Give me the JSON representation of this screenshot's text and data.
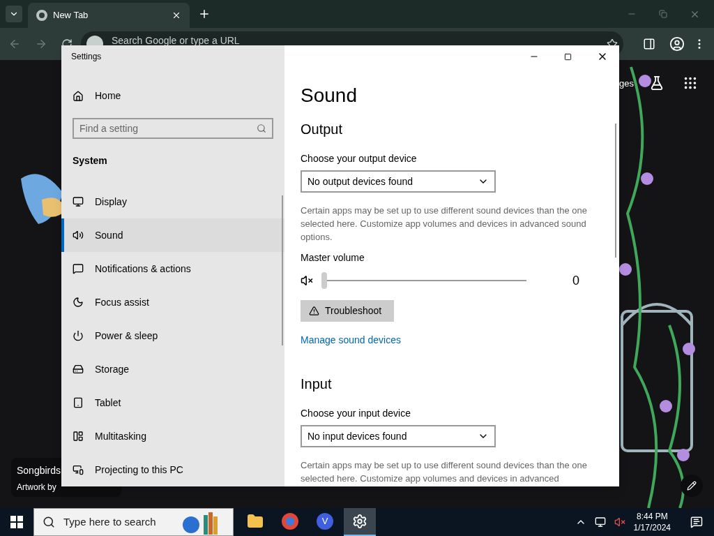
{
  "browser": {
    "tabs": [
      {
        "label": "New Tab",
        "selected": true
      }
    ],
    "omnibox": {
      "placeholder": "Search Google or type a URL"
    },
    "corner_link": "ges",
    "wallpaper_caption": {
      "title": "Songbirds",
      "credit": "Artwork by"
    }
  },
  "settings_window": {
    "title": "Settings",
    "home": "Home",
    "search": {
      "placeholder": "Find a setting"
    },
    "section": "System",
    "sidebar_items": [
      {
        "label": "Display",
        "selected": false
      },
      {
        "label": "Sound",
        "selected": true
      },
      {
        "label": "Notifications & actions",
        "selected": false
      },
      {
        "label": "Focus assist",
        "selected": false
      },
      {
        "label": "Power & sleep",
        "selected": false
      },
      {
        "label": "Storage",
        "selected": false
      },
      {
        "label": "Tablet",
        "selected": false
      },
      {
        "label": "Multitasking",
        "selected": false
      },
      {
        "label": "Projecting to this PC",
        "selected": false
      }
    ],
    "page_title": "Sound",
    "output": {
      "heading": "Output",
      "device_label": "Choose your output device",
      "device": "No output devices found",
      "note": "Certain apps may be set up to use different sound devices than the one selected here. Customize app volumes and devices in advanced sound options.",
      "volume_label": "Master volume",
      "muted": true,
      "level": 0,
      "reading": "0",
      "troubleshoot": "Troubleshoot",
      "manage_link": "Manage sound devices"
    },
    "input": {
      "heading": "Input",
      "device_label": "Choose your input device",
      "device": "No input devices found",
      "note": "Certain apps may be set up to use different sound devices than the one selected here. Customize app volumes and devices in advanced"
    }
  },
  "taskbar": {
    "search": {
      "placeholder": "Type here to search"
    },
    "apps": [
      {
        "kind": "explorer",
        "selected": false
      },
      {
        "kind": "chrome",
        "selected": false
      },
      {
        "kind": "v",
        "label": "V",
        "selected": false
      },
      {
        "kind": "settings",
        "selected": true
      }
    ],
    "time": "8:44 PM",
    "date": "1/17/2024"
  }
}
